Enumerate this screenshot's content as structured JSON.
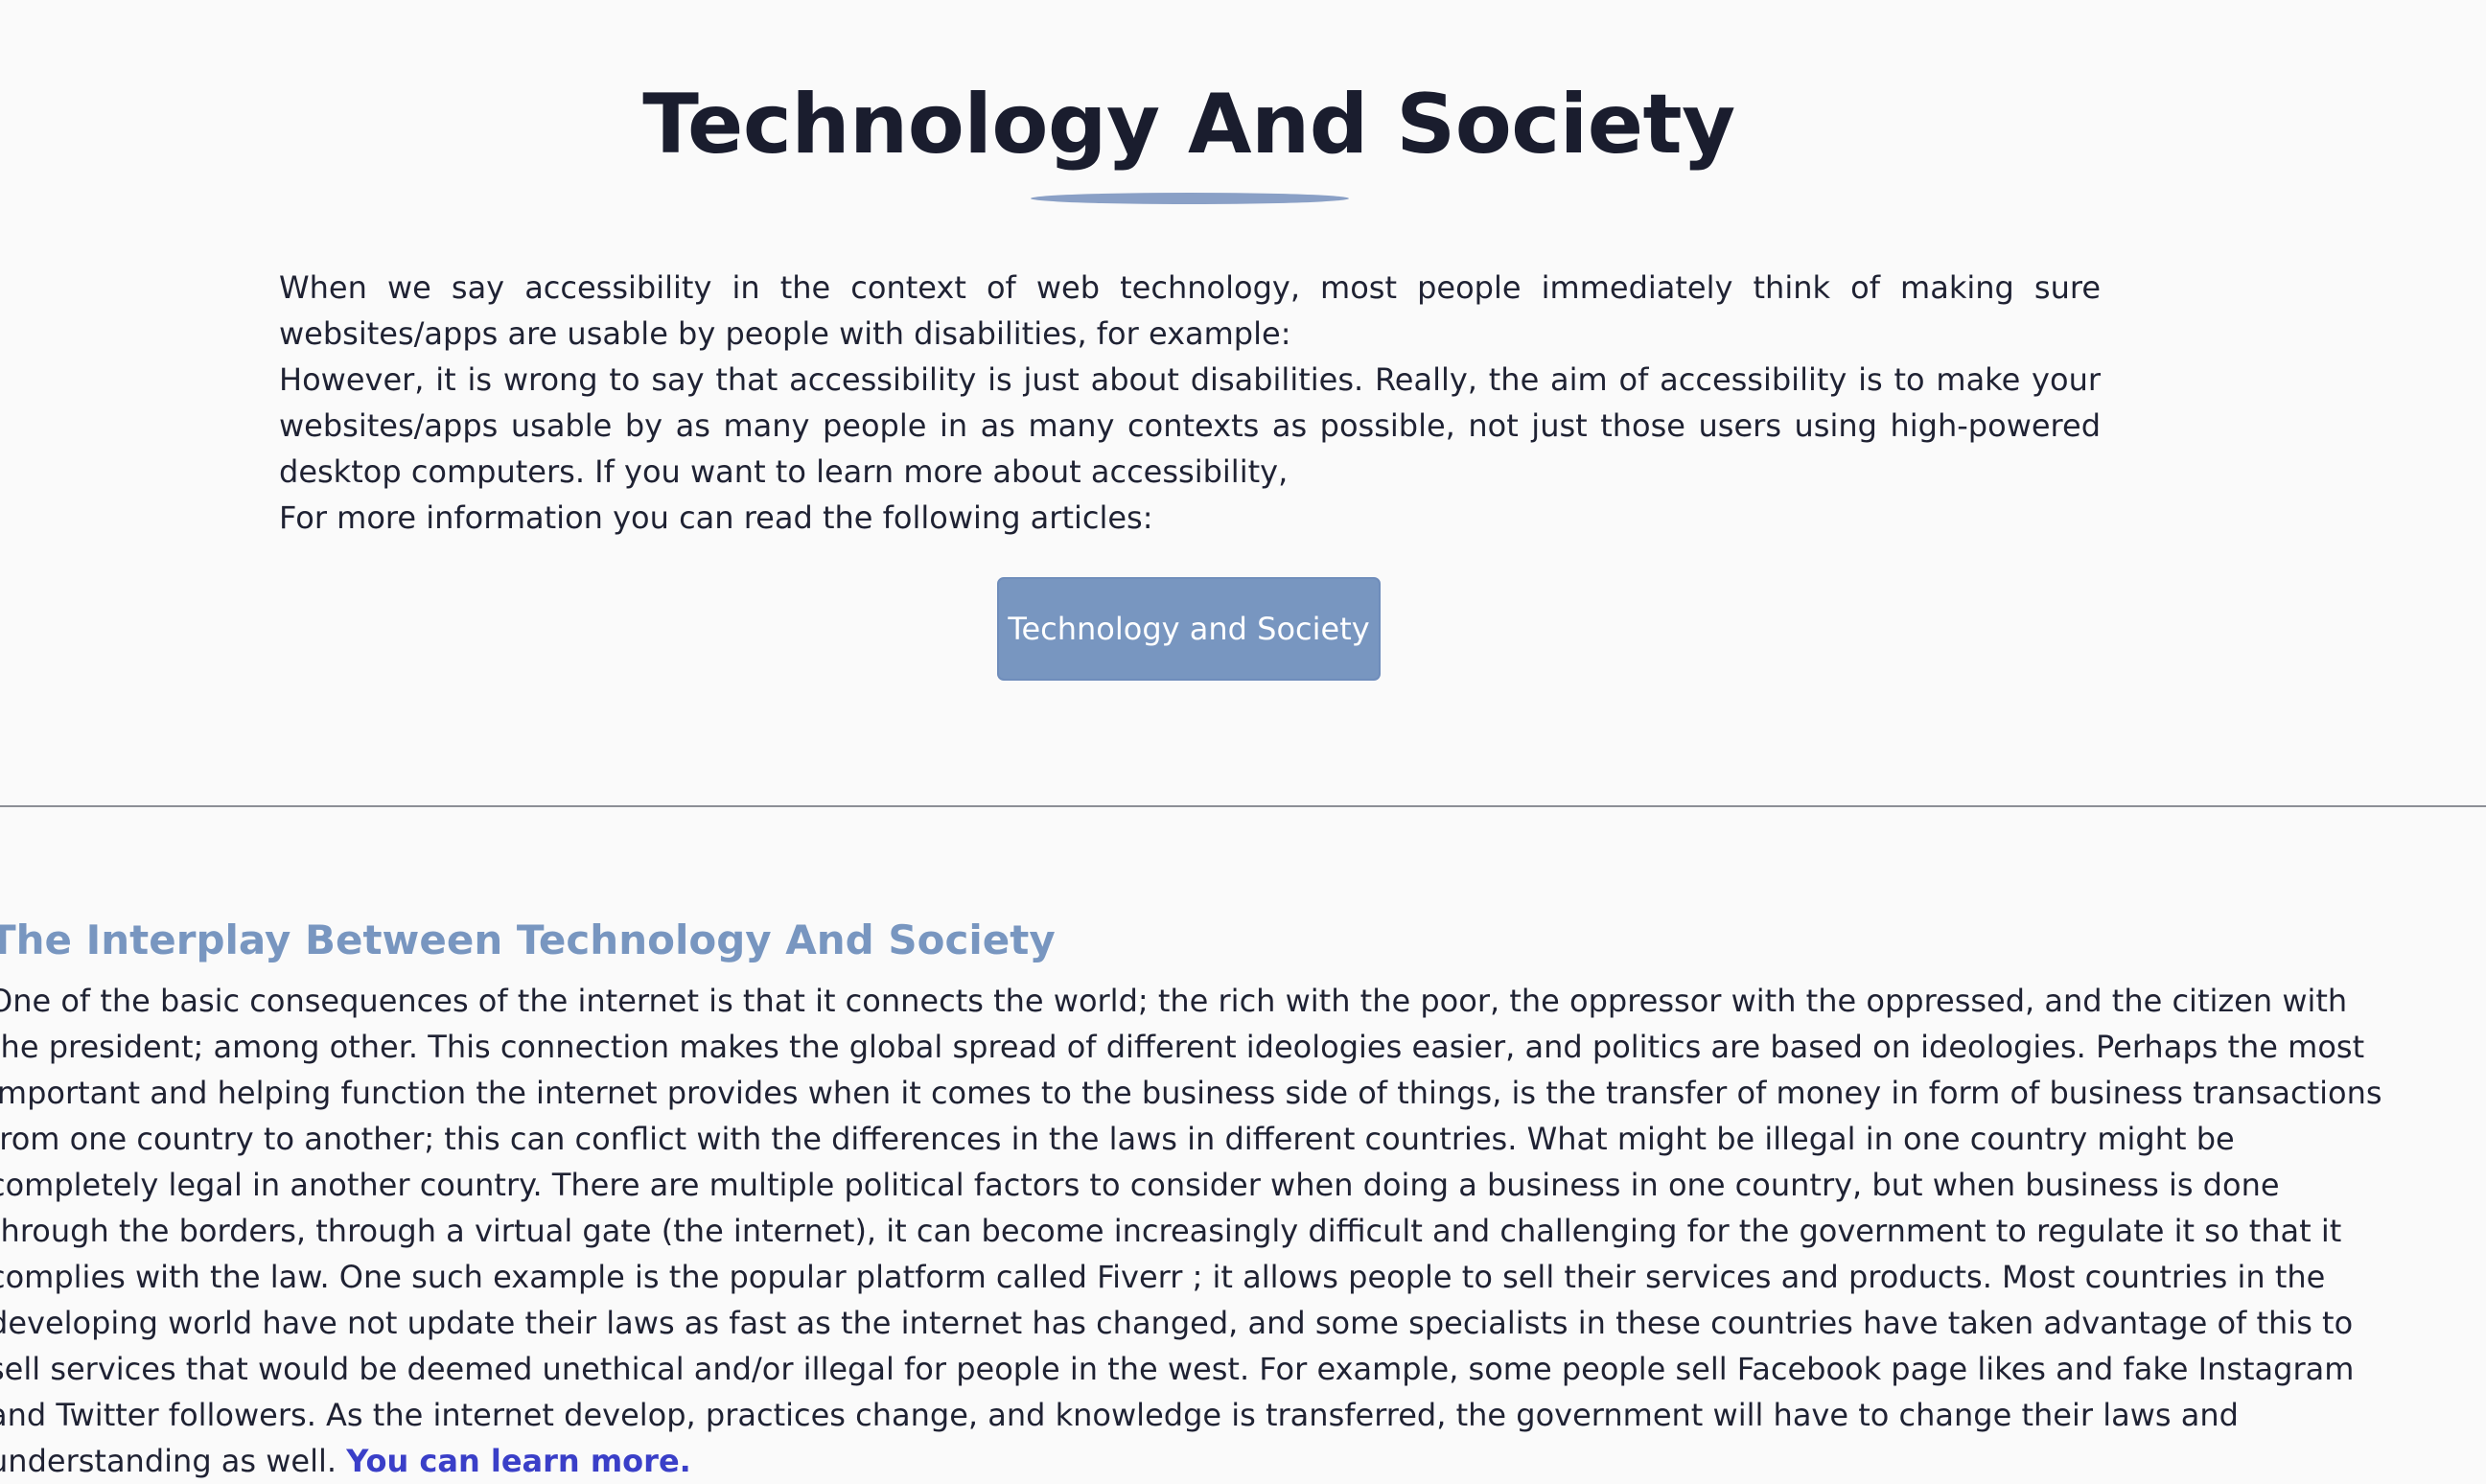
{
  "hero": {
    "title": "Technology And Society",
    "intro_paragraphs": [
      "When we say accessibility in the context of web technology, most people immediately think of making sure websites/apps are usable by people with disabilities, for example:",
      "However, it is wrong to say that accessibility is just about disabilities. Really, the aim of accessibility is to make your websites/apps usable by as many people in as many contexts as possible, not just those users using high-powered desktop computers. If you want to learn more about accessibility,",
      "For more information you can read the following articles:"
    ],
    "button_label": "Technology and Society"
  },
  "section": {
    "heading": "The Interplay Between Technology And Society",
    "body": "One of the basic consequences of the internet is that it connects the world; the rich with the poor, the oppressor with the oppressed, and the citizen with the president; among other. This connection makes the global spread of different ideologies easier, and politics are based on ideologies. Perhaps the most important and helping function the internet provides when it comes to the business side of things, is the transfer of money in form of business transactions from one country to another; this can conflict with the differences in the laws in different countries. What might be illegal in one country might be completely legal in another country. There are multiple political factors to consider when doing a business in one country, but when business is done through the borders, through a virtual gate (the internet), it can become increasingly difficult and challenging for the government to regulate it so that it complies with the law. One such example is the popular platform called Fiverr ; it allows people to sell their services and products. Most countries in the developing world have not update their laws as fast as the internet has changed, and some specialists in these countries have taken advantage of this to sell services that would be deemed unethical and/or illegal for people in the west. For example, some people sell Facebook page likes and fake Instagram and Twitter followers. As the internet develop, practices change, and knowledge is transferred, the government will have to change their laws and understanding as well.",
    "link_label": "You can learn more."
  },
  "colors": {
    "background": "#fafafa",
    "text": "#1a1d2e",
    "accent": "#7896c0",
    "link": "#3a3fc8",
    "divider": "#8c8f96"
  }
}
